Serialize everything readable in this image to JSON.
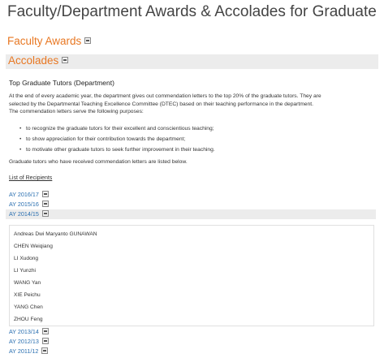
{
  "page_title": "Faculty/Department Awards & Accolades for Graduate",
  "faculty_awards_label": "Faculty Awards",
  "accolades_label": "Accolades",
  "section": {
    "heading": "Top Graduate Tutors (Department)",
    "intro_lines": [
      "At the end of every academic year, the department gives out commendation letters to the top 20% of the graduate tutors. They are",
      "selected by the Departmental Teaching Excellence Committee (DTEC) based on their teaching performance in the department.",
      "The commendation letters serve the following purposes:"
    ],
    "purposes": [
      "to recognize the graduate tutors for their excellent and conscientious teaching;",
      "to show appreciation for their contribution towards the department;",
      "to motivate other graduate tutors to seek further improvement in their teaching."
    ],
    "listed_below": "Graduate tutors who have received commendation letters are listed below.",
    "list_of_recipients": "List of Recipients"
  },
  "years_before": [
    "AY 2016/17",
    "AY 2015/16"
  ],
  "open_year": {
    "label": "AY 2014/15",
    "recipients": [
      "Andreas Dwi Maryanto GUNAWAN",
      "CHEN Weiqiang",
      "LI Xudong",
      "LI Yunzhi",
      "WANG Yan",
      "XIE Peichu",
      "YANG Chen",
      "ZHOU Feng"
    ]
  },
  "years_after": [
    "AY 2013/14",
    "AY 2012/13",
    "AY 2011/12"
  ],
  "colors": {
    "accent_orange": "#e87722",
    "link_blue": "#2a6fb0",
    "bar_gray": "#ececec"
  }
}
